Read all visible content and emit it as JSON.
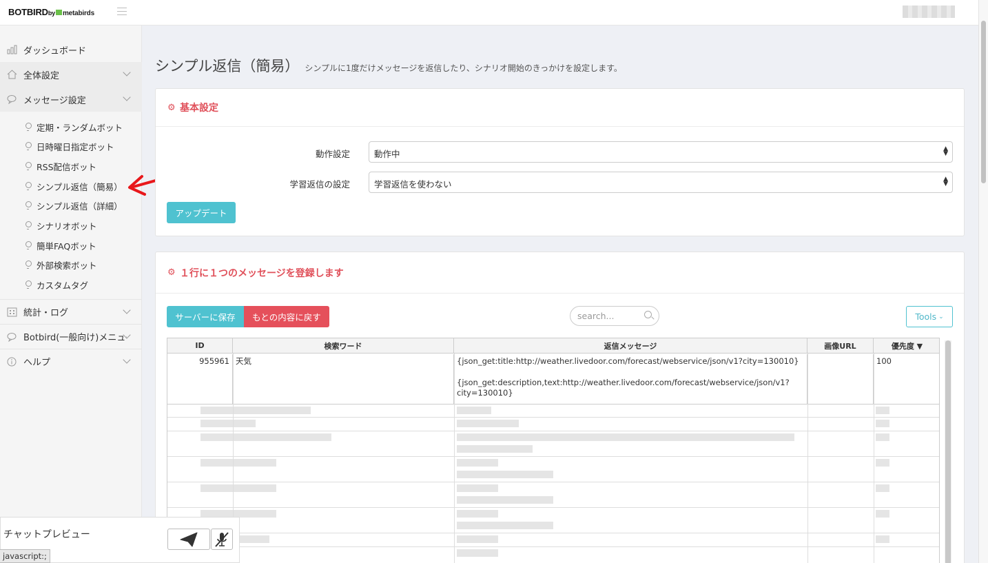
{
  "topbar": {
    "logo_main": "BOTBIRD",
    "logo_by": "by",
    "logo_partner": "metabirds"
  },
  "sidebar": {
    "items": [
      {
        "label": "ダッシュボード",
        "icon": "bar-chart-icon"
      },
      {
        "label": "全体設定",
        "icon": "home-icon"
      },
      {
        "label": "メッセージ設定",
        "icon": "chat-bubble-icon"
      }
    ],
    "sub_items": [
      "定期・ランダムボット",
      "日時曜日指定ボット",
      "RSS配信ボット",
      "シンプル返信（簡易）",
      "シンプル返信（詳細）",
      "シナリオボット",
      "簡単FAQボット",
      "外部検索ボット",
      "カスタムタグ"
    ],
    "items_bottom": [
      {
        "label": "統計・ログ",
        "icon": "grid-icon"
      },
      {
        "label": "Botbird(一般向け)メニュー",
        "icon": "chat-bubble-icon"
      },
      {
        "label": "ヘルプ",
        "icon": "info-icon"
      }
    ]
  },
  "page": {
    "title": "シンプル返信（簡易）",
    "subtitle": "シンプルに1度だけメッセージを返信したり、シナリオ開始のきっかけを設定します。"
  },
  "basic": {
    "heading": "基本設定",
    "row1_label": "動作設定",
    "row1_value": "動作中",
    "row2_label": "学習返信の設定",
    "row2_value": "学習返信を使わない",
    "update_button": "アップデート"
  },
  "messages": {
    "heading": "１行に１つのメッセージを登録します",
    "save_button": "サーバーに保存",
    "revert_button": "もとの内容に戻す",
    "search_placeholder": "search...",
    "tools_button": "Tools",
    "columns": [
      "ID",
      "検索ワード",
      "返信メッセージ",
      "画像URL",
      "優先度 ▼"
    ],
    "first_row": {
      "id": "955961",
      "keyword": "天気",
      "reply_line1": "{json_get:title:http://weather.livedoor.com/forecast/webservice/json/v1?city=130010}",
      "reply_line2": "{json_get:description,text:http://weather.livedoor.com/forecast/webservice/json/v1?city=130010}",
      "image_url": "",
      "priority": "100"
    }
  },
  "chat": {
    "title": "チャットプレビュー"
  },
  "status_bar": "javascript:;",
  "colors": {
    "accent_teal": "#4fc2d0",
    "accent_red": "#e5505b",
    "heading_red": "#e0505a"
  }
}
